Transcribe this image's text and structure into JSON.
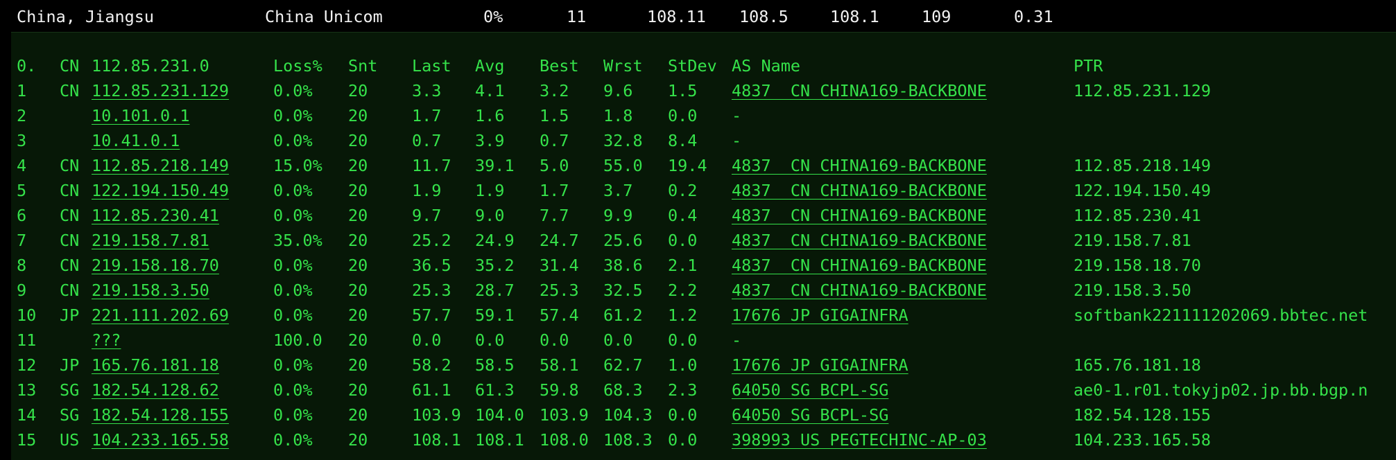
{
  "summary": {
    "location": "China, Jiangsu",
    "isp": "China Unicom",
    "loss": "0%",
    "hops": "11",
    "latency": "108.11",
    "min": "108.5",
    "avg": "108.1",
    "max": "109",
    "stdev": "0.31"
  },
  "colors": {
    "background": "#000000",
    "panel": "#071807",
    "text": "#35e24a",
    "summary_text": "#f2f2f2"
  },
  "table": {
    "header": {
      "hop": "0.",
      "cc": "CN",
      "host": "112.85.231.0",
      "loss": "Loss%",
      "snt": "Snt",
      "last": "Last",
      "avg": "Avg",
      "best": "Best",
      "wrst": "Wrst",
      "stdev": "StDev",
      "as": "AS Name",
      "ptr": "PTR"
    },
    "rows": [
      {
        "hop": "1",
        "cc": "CN",
        "host": "112.85.231.129",
        "loss": "0.0%",
        "snt": "20",
        "last": "3.3",
        "avg": "4.1",
        "best": "3.2",
        "wrst": "9.6",
        "stdev": "1.5",
        "as": "4837  CN CHINA169-BACKBONE",
        "ptr": "112.85.231.129"
      },
      {
        "hop": "2",
        "cc": "",
        "host": "10.101.0.1",
        "loss": "0.0%",
        "snt": "20",
        "last": "1.7",
        "avg": "1.6",
        "best": "1.5",
        "wrst": "1.8",
        "stdev": "0.0",
        "as": "-",
        "ptr": ""
      },
      {
        "hop": "3",
        "cc": "",
        "host": "10.41.0.1",
        "loss": "0.0%",
        "snt": "20",
        "last": "0.7",
        "avg": "3.9",
        "best": "0.7",
        "wrst": "32.8",
        "stdev": "8.4",
        "as": "-",
        "ptr": ""
      },
      {
        "hop": "4",
        "cc": "CN",
        "host": "112.85.218.149",
        "loss": "15.0%",
        "snt": "20",
        "last": "11.7",
        "avg": "39.1",
        "best": "5.0",
        "wrst": "55.0",
        "stdev": "19.4",
        "as": "4837  CN CHINA169-BACKBONE",
        "ptr": "112.85.218.149"
      },
      {
        "hop": "5",
        "cc": "CN",
        "host": "122.194.150.49",
        "loss": "0.0%",
        "snt": "20",
        "last": "1.9",
        "avg": "1.9",
        "best": "1.7",
        "wrst": "3.7",
        "stdev": "0.2",
        "as": "4837  CN CHINA169-BACKBONE",
        "ptr": "122.194.150.49"
      },
      {
        "hop": "6",
        "cc": "CN",
        "host": "112.85.230.41",
        "loss": "0.0%",
        "snt": "20",
        "last": "9.7",
        "avg": "9.0",
        "best": "7.7",
        "wrst": "9.9",
        "stdev": "0.4",
        "as": "4837  CN CHINA169-BACKBONE",
        "ptr": "112.85.230.41"
      },
      {
        "hop": "7",
        "cc": "CN",
        "host": "219.158.7.81",
        "loss": "35.0%",
        "snt": "20",
        "last": "25.2",
        "avg": "24.9",
        "best": "24.7",
        "wrst": "25.6",
        "stdev": "0.0",
        "as": "4837  CN CHINA169-BACKBONE",
        "ptr": "219.158.7.81"
      },
      {
        "hop": "8",
        "cc": "CN",
        "host": "219.158.18.70",
        "loss": "0.0%",
        "snt": "20",
        "last": "36.5",
        "avg": "35.2",
        "best": "31.4",
        "wrst": "38.6",
        "stdev": "2.1",
        "as": "4837  CN CHINA169-BACKBONE",
        "ptr": "219.158.18.70"
      },
      {
        "hop": "9",
        "cc": "CN",
        "host": "219.158.3.50",
        "loss": "0.0%",
        "snt": "20",
        "last": "25.3",
        "avg": "28.7",
        "best": "25.3",
        "wrst": "32.5",
        "stdev": "2.2",
        "as": "4837  CN CHINA169-BACKBONE",
        "ptr": "219.158.3.50"
      },
      {
        "hop": "10",
        "cc": "JP",
        "host": "221.111.202.69",
        "loss": "0.0%",
        "snt": "20",
        "last": "57.7",
        "avg": "59.1",
        "best": "57.4",
        "wrst": "61.2",
        "stdev": "1.2",
        "as": "17676 JP GIGAINFRA",
        "ptr": "softbank221111202069.bbtec.net"
      },
      {
        "hop": "11",
        "cc": "",
        "host": "???",
        "loss": "100.0",
        "snt": "20",
        "last": "0.0",
        "avg": "0.0",
        "best": "0.0",
        "wrst": "0.0",
        "stdev": "0.0",
        "as": "-",
        "ptr": ""
      },
      {
        "hop": "12",
        "cc": "JP",
        "host": "165.76.181.18",
        "loss": "0.0%",
        "snt": "20",
        "last": "58.2",
        "avg": "58.5",
        "best": "58.1",
        "wrst": "62.7",
        "stdev": "1.0",
        "as": "17676 JP GIGAINFRA",
        "ptr": "165.76.181.18"
      },
      {
        "hop": "13",
        "cc": "SG",
        "host": "182.54.128.62",
        "loss": "0.0%",
        "snt": "20",
        "last": "61.1",
        "avg": "61.3",
        "best": "59.8",
        "wrst": "68.3",
        "stdev": "2.3",
        "as": "64050 SG BCPL-SG",
        "ptr": "ae0-1.r01.tokyjp02.jp.bb.bgp.n"
      },
      {
        "hop": "14",
        "cc": "SG",
        "host": "182.54.128.155",
        "loss": "0.0%",
        "snt": "20",
        "last": "103.9",
        "avg": "104.0",
        "best": "103.9",
        "wrst": "104.3",
        "stdev": "0.0",
        "as": "64050 SG BCPL-SG",
        "ptr": "182.54.128.155"
      },
      {
        "hop": "15",
        "cc": "US",
        "host": "104.233.165.58",
        "loss": "0.0%",
        "snt": "20",
        "last": "108.1",
        "avg": "108.1",
        "best": "108.0",
        "wrst": "108.3",
        "stdev": "0.0",
        "as": "398993 US PEGTECHINC-AP-03",
        "ptr": "104.233.165.58"
      }
    ]
  }
}
